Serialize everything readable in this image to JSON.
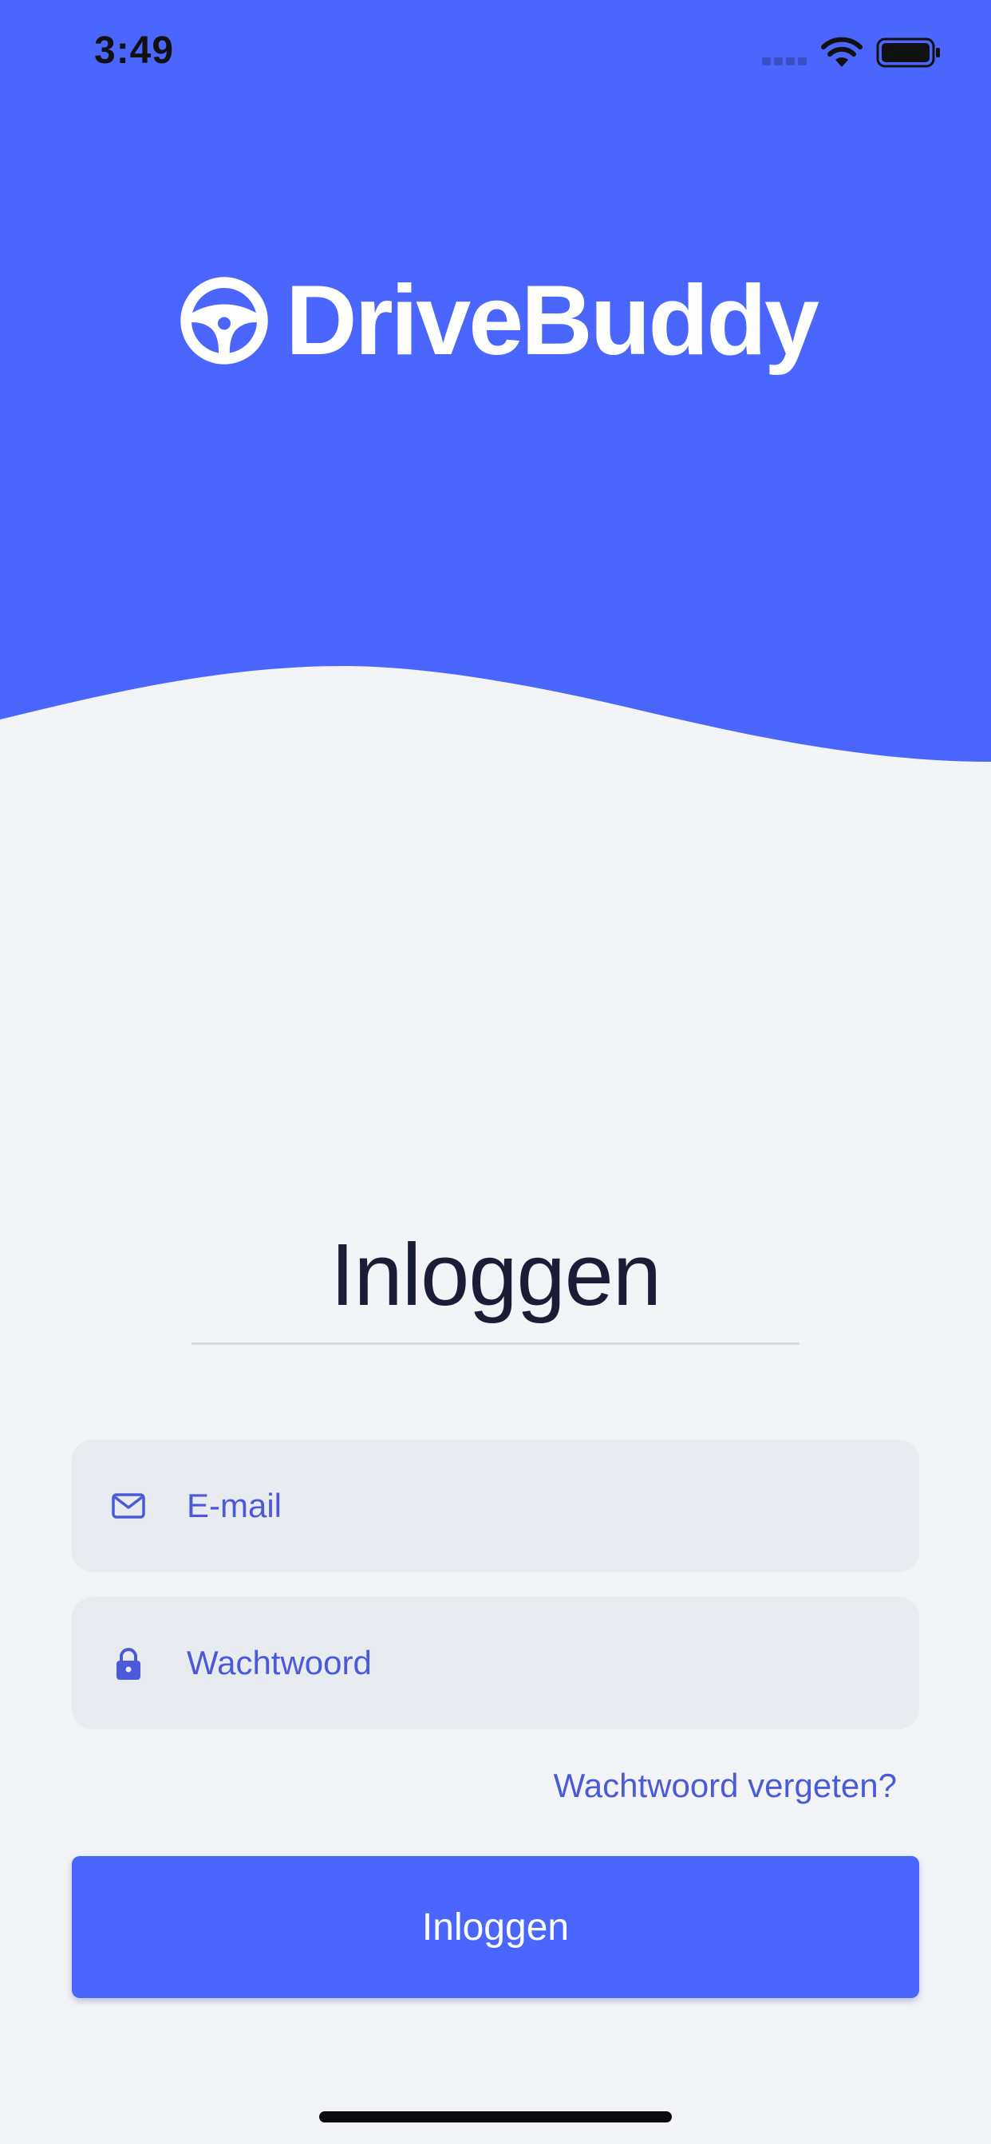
{
  "status_bar": {
    "time": "3:49",
    "icons": [
      "cellular-signal-icon",
      "wifi-icon",
      "battery-icon"
    ]
  },
  "brand": {
    "name": "DriveBuddy",
    "logo_icon": "steering-wheel-icon"
  },
  "login": {
    "title": "Inloggen",
    "email_placeholder": "E-mail",
    "email_value": "",
    "email_icon": "mail-icon",
    "password_placeholder": "Wachtwoord",
    "password_value": "",
    "password_icon": "lock-icon",
    "forgot_password": "Wachtwoord vergeten?",
    "submit_label": "Inloggen"
  },
  "colors": {
    "primary": "#4a66ff",
    "background": "#f2f4f7",
    "field_background": "#e8ebef",
    "title_text": "#1b1d36",
    "accent_text": "#4a5ad8"
  }
}
